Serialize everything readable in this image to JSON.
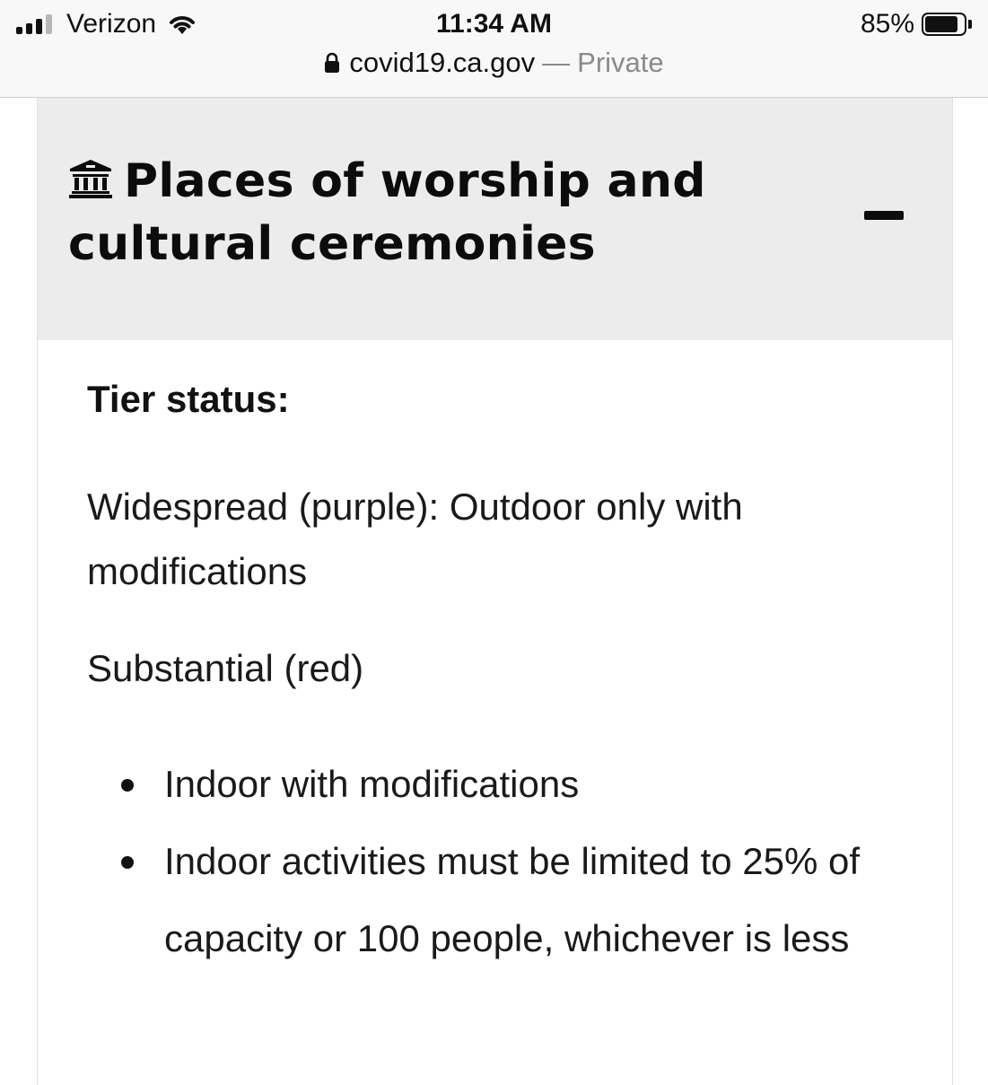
{
  "status_bar": {
    "carrier": "Verizon",
    "signal_bars_active": 3,
    "signal_bars_total": 4,
    "time": "11:34 AM",
    "battery_percent_text": "85%",
    "battery_level": 0.85
  },
  "browser": {
    "domain": "covid19.ca.gov",
    "separator": "—",
    "mode": "Private"
  },
  "section": {
    "icon": "bank-building-icon",
    "title": "Places of worship and cultural ceremonies",
    "expanded": true,
    "tier_label": "Tier status:",
    "widespread_text": "Widespread (purple): Outdoor only with modifications",
    "substantial_text": "Substantial (red)",
    "bullets": [
      "Indoor with modifications",
      "Indoor activities must be limited to 25% of capacity or 100 people, whichever is less"
    ]
  },
  "colors": {
    "header_background": "#ececec",
    "text": "#111111",
    "muted": "#8a8a8a"
  }
}
